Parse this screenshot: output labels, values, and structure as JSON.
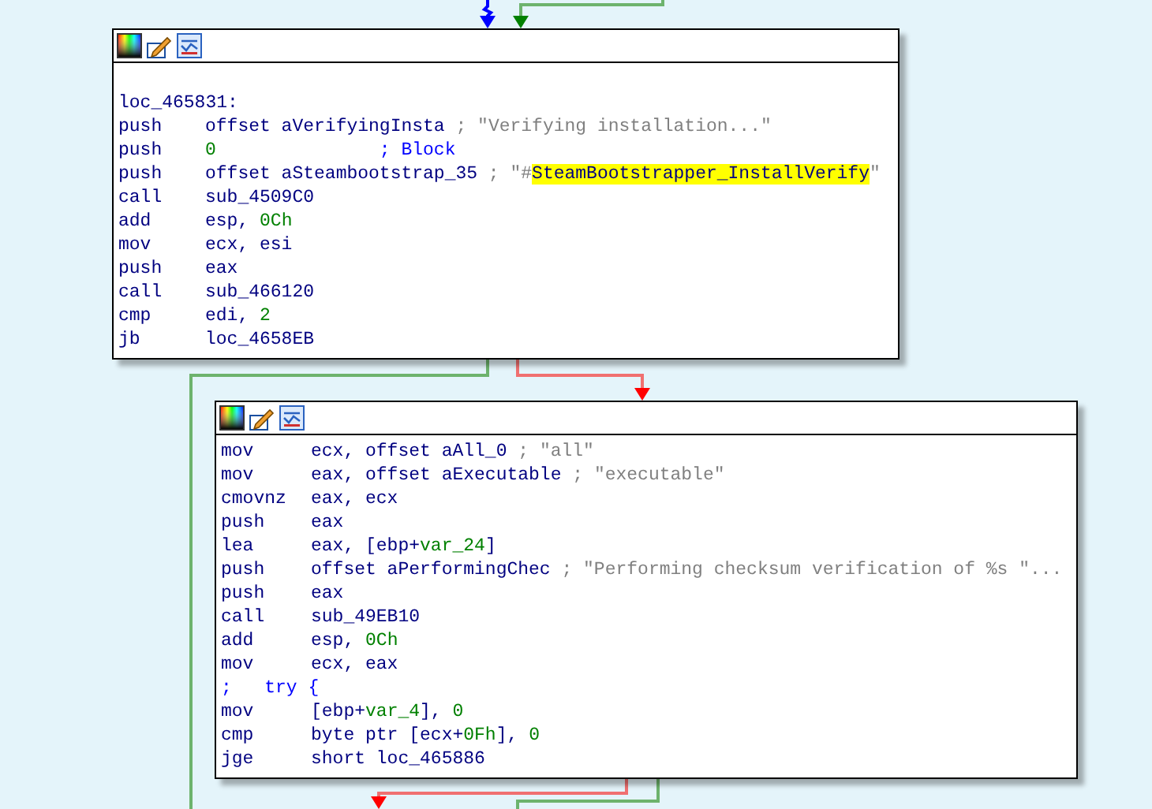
{
  "blocks": [
    {
      "label": "loc_465831:",
      "lines": [
        {
          "op": "push",
          "args": [
            {
              "text": "offset aVerifyingInsta",
              "kind": "name"
            },
            {
              "text": " ; ",
              "kind": "str"
            },
            {
              "text": "\"Verifying installation...\"",
              "kind": "str"
            }
          ]
        },
        {
          "op": "push",
          "args": [
            {
              "text": "0",
              "kind": "num"
            },
            {
              "text": "               ; Block",
              "kind": "comment"
            }
          ]
        },
        {
          "op": "push",
          "args": [
            {
              "text": "offset aSteambootstrap_35",
              "kind": "name"
            },
            {
              "text": " ; \"#",
              "kind": "str"
            },
            {
              "text": "SteamBootstrapper_InstallVerify",
              "kind": "hl"
            },
            {
              "text": "\"",
              "kind": "str"
            }
          ]
        },
        {
          "op": "call",
          "args": [
            {
              "text": "sub_4509C0",
              "kind": "name"
            }
          ]
        },
        {
          "op": "add",
          "args": [
            {
              "text": "esp, ",
              "kind": "name"
            },
            {
              "text": "0Ch",
              "kind": "num"
            }
          ]
        },
        {
          "op": "mov",
          "args": [
            {
              "text": "ecx, esi",
              "kind": "name"
            }
          ]
        },
        {
          "op": "push",
          "args": [
            {
              "text": "eax",
              "kind": "name"
            }
          ]
        },
        {
          "op": "call",
          "args": [
            {
              "text": "sub_466120",
              "kind": "name"
            }
          ]
        },
        {
          "op": "cmp",
          "args": [
            {
              "text": "edi, ",
              "kind": "name"
            },
            {
              "text": "2",
              "kind": "num"
            }
          ]
        },
        {
          "op": "jb",
          "args": [
            {
              "text": "loc_4658EB",
              "kind": "name"
            }
          ]
        }
      ]
    },
    {
      "lines": [
        {
          "op": "mov",
          "args": [
            {
              "text": "ecx, offset aAll_0",
              "kind": "name"
            },
            {
              "text": " ; \"all\"",
              "kind": "str"
            }
          ]
        },
        {
          "op": "mov",
          "args": [
            {
              "text": "eax, offset aExecutable",
              "kind": "name"
            },
            {
              "text": " ; \"executable\"",
              "kind": "str"
            }
          ]
        },
        {
          "op": "cmovnz",
          "args": [
            {
              "text": "eax, ecx",
              "kind": "name"
            }
          ]
        },
        {
          "op": "push",
          "args": [
            {
              "text": "eax",
              "kind": "name"
            }
          ]
        },
        {
          "op": "lea",
          "args": [
            {
              "text": "eax, [ebp+",
              "kind": "name"
            },
            {
              "text": "var_24",
              "kind": "num"
            },
            {
              "text": "]",
              "kind": "name"
            }
          ]
        },
        {
          "op": "push",
          "args": [
            {
              "text": "offset aPerformingChec",
              "kind": "name"
            },
            {
              "text": " ; \"Performing checksum verification of %s \"...",
              "kind": "str"
            }
          ]
        },
        {
          "op": "push",
          "args": [
            {
              "text": "eax",
              "kind": "name"
            }
          ]
        },
        {
          "op": "call",
          "args": [
            {
              "text": "sub_49EB10",
              "kind": "name"
            }
          ]
        },
        {
          "op": "add",
          "args": [
            {
              "text": "esp, ",
              "kind": "name"
            },
            {
              "text": "0Ch",
              "kind": "num"
            }
          ]
        },
        {
          "op": "mov",
          "args": [
            {
              "text": "ecx, eax",
              "kind": "name"
            }
          ]
        },
        {
          "op": ";",
          "args": [
            {
              "text": "try {",
              "kind": "comment"
            }
          ],
          "kind": "comment"
        },
        {
          "op": "mov",
          "args": [
            {
              "text": "[ebp+",
              "kind": "name"
            },
            {
              "text": "var_4",
              "kind": "num"
            },
            {
              "text": "], ",
              "kind": "name"
            },
            {
              "text": "0",
              "kind": "num"
            }
          ]
        },
        {
          "op": "cmp",
          "args": [
            {
              "text": "byte ptr [ecx+",
              "kind": "name"
            },
            {
              "text": "0Fh",
              "kind": "num"
            },
            {
              "text": "], ",
              "kind": "name"
            },
            {
              "text": "0",
              "kind": "num"
            }
          ]
        },
        {
          "op": "jge",
          "args": [
            {
              "text": "short loc_465886",
              "kind": "name"
            }
          ]
        }
      ]
    }
  ],
  "edges": [
    {
      "kind": "direct"
    },
    {
      "kind": "taken"
    },
    {
      "kind": "taken"
    },
    {
      "kind": "not_taken"
    },
    {
      "kind": "not_taken"
    },
    {
      "kind": "taken"
    }
  ]
}
